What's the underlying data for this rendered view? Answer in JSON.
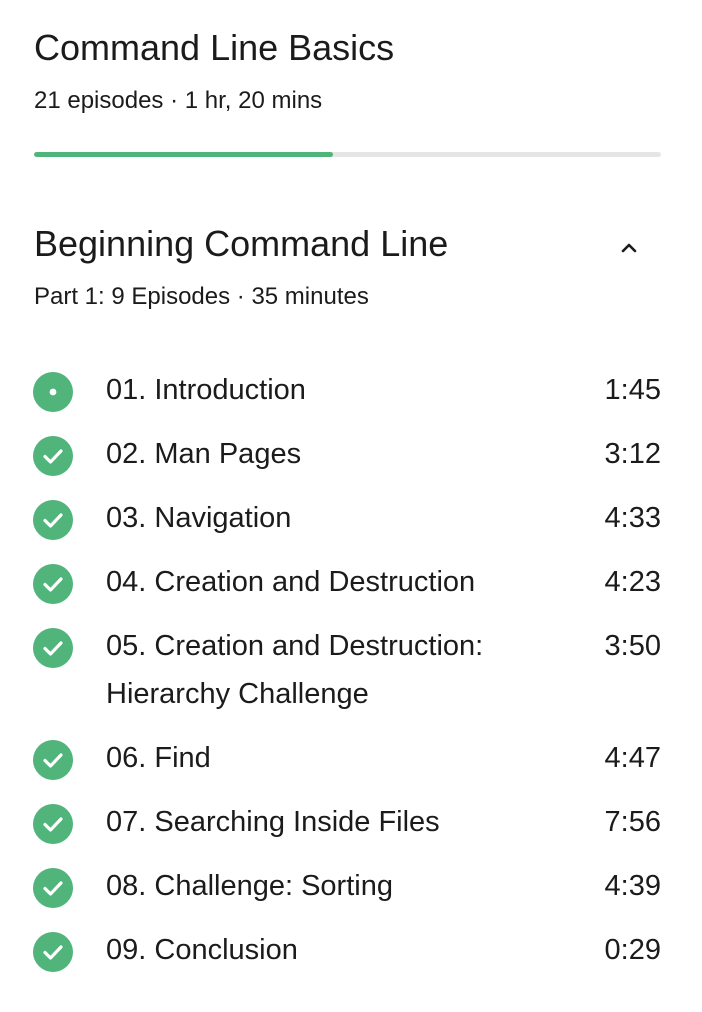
{
  "course": {
    "title": "Command Line Basics",
    "meta": "21 episodes · 1 hr, 20 mins",
    "progress_fraction": 0.477,
    "accent_color": "#50b47b",
    "track_color": "#e5e5e5"
  },
  "section": {
    "title": "Beginning Command Line",
    "meta": "Part 1: 9 Episodes · 35 minutes",
    "toggle_icon": "chevron-up-icon"
  },
  "episodes": [
    {
      "title": "01. Introduction",
      "duration": "1:45",
      "status": "current",
      "icon": "current-dot-icon"
    },
    {
      "title": "02. Man Pages",
      "duration": "3:12",
      "status": "completed",
      "icon": "check-circle-icon"
    },
    {
      "title": "03. Navigation",
      "duration": "4:33",
      "status": "completed",
      "icon": "check-circle-icon"
    },
    {
      "title": "04. Creation and Destruction",
      "duration": "4:23",
      "status": "completed",
      "icon": "check-circle-icon"
    },
    {
      "title": "05. Creation and Destruction: Hierarchy Challenge",
      "duration": "3:50",
      "status": "completed",
      "icon": "check-circle-icon"
    },
    {
      "title": "06. Find",
      "duration": "4:47",
      "status": "completed",
      "icon": "check-circle-icon"
    },
    {
      "title": "07. Searching Inside Files",
      "duration": "7:56",
      "status": "completed",
      "icon": "check-circle-icon"
    },
    {
      "title": "08. Challenge: Sorting",
      "duration": "4:39",
      "status": "completed",
      "icon": "check-circle-icon"
    },
    {
      "title": "09. Conclusion",
      "duration": "0:29",
      "status": "completed",
      "icon": "check-circle-icon"
    }
  ]
}
